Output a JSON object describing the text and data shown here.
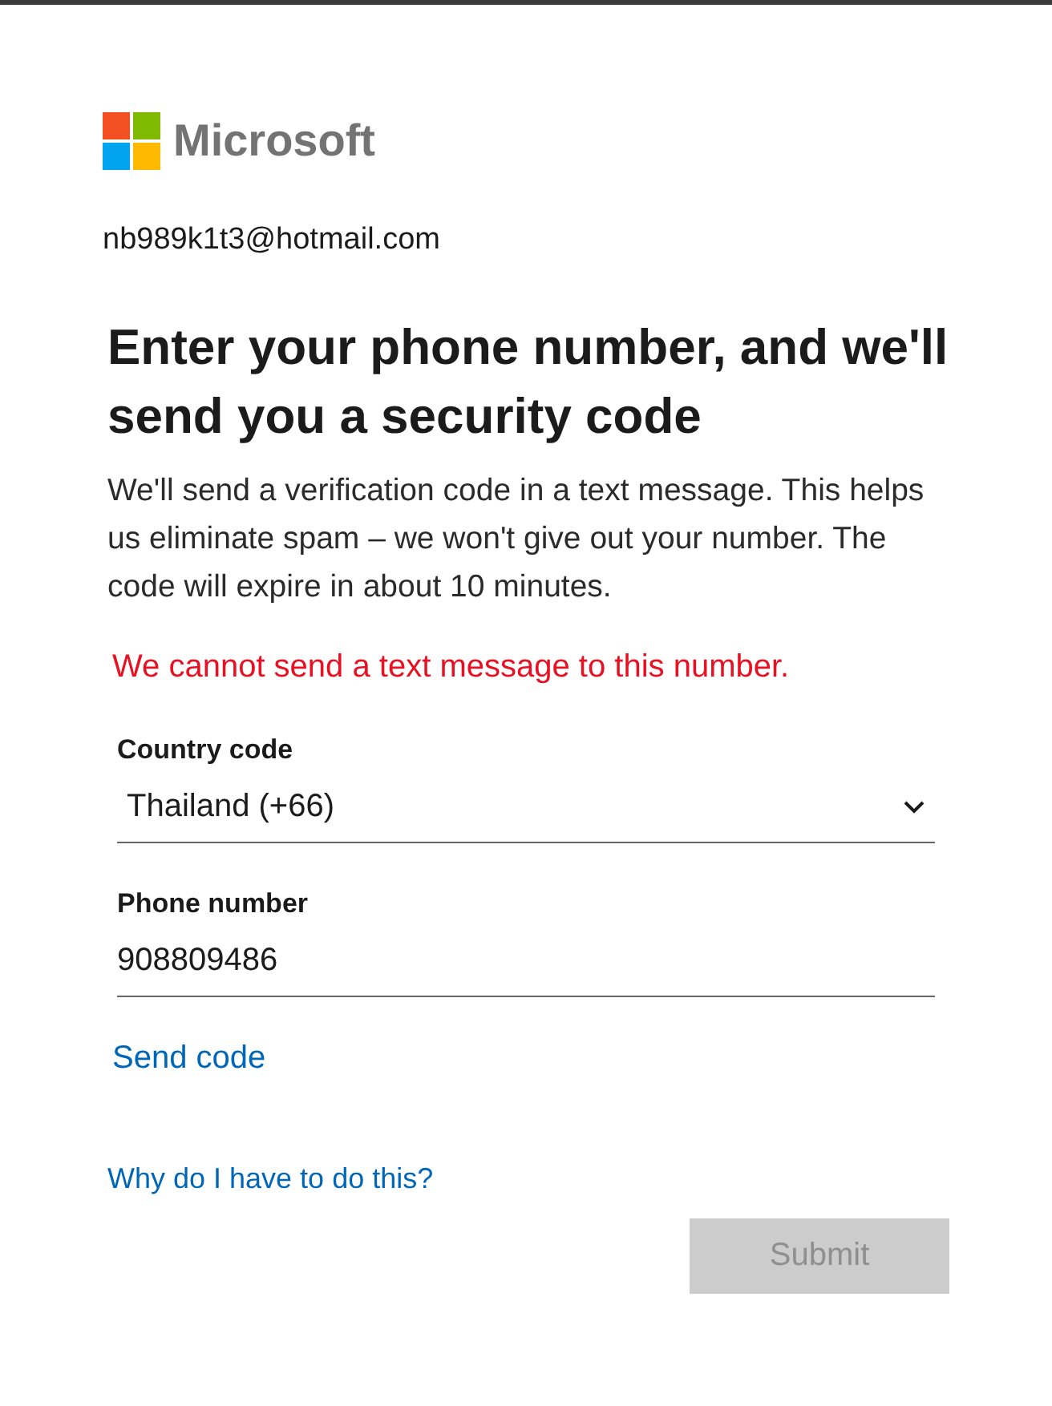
{
  "logo": {
    "text": "Microsoft"
  },
  "account": "nb989k1t3@hotmail.com",
  "title": "Enter your phone number, and we'll send you a security code",
  "description": "We'll send a verification code in a text message. This helps us eliminate spam – we won't give out your number. The code will expire in about 10 minutes.",
  "error": "We cannot send a text message to this number.",
  "fields": [
    {
      "kind": "select",
      "label": "Country code",
      "value": "Thailand (+66)"
    },
    {
      "kind": "text",
      "label": "Phone number",
      "value": "908809486"
    }
  ],
  "send_code_link": "Send code",
  "help_link": "Why do I have to do this?",
  "submit": {
    "label": "Submit",
    "disabled": true
  }
}
